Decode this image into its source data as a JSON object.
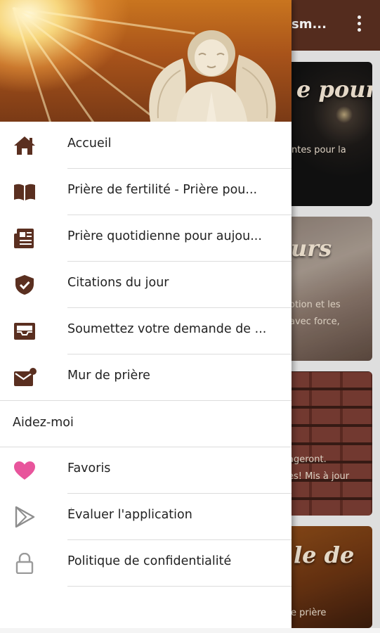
{
  "app_bar": {
    "title": "sm...",
    "color": "#5a2f20"
  },
  "background_cards": [
    {
      "title": "e pour",
      "lines": [
        "ntes pour la"
      ]
    },
    {
      "title": "urs",
      "lines": [
        "otion et les",
        "avec force,"
      ]
    },
    {
      "title": "",
      "lines": [
        "ageront.",
        "es! Mis à jour"
      ]
    },
    {
      "title": "le de",
      "lines": [
        "e prière"
      ]
    }
  ],
  "drawer": {
    "header_image": "praying-angel-statue-sunlight",
    "icon_color": "#5a2f20",
    "items": [
      {
        "label": "Accueil",
        "icon": "home-icon"
      },
      {
        "label": "Prière de fertilité - Prière pou...",
        "icon": "book-icon"
      },
      {
        "label": "Prière quotidienne pour aujou...",
        "icon": "newspaper-icon"
      },
      {
        "label": "Citations du jour",
        "icon": "shield-check-icon"
      },
      {
        "label": "Soumettez votre demande de ...",
        "icon": "inbox-icon"
      },
      {
        "label": "Mur de prière",
        "icon": "mail-notification-icon"
      }
    ],
    "section_header": "Aidez-moi",
    "help_items": [
      {
        "label": "Favoris",
        "icon": "heart-icon",
        "color": "#e8559c"
      },
      {
        "label": "Évaluer l'application",
        "icon": "play-store-icon",
        "color": "#8e8e8e"
      },
      {
        "label": "Politique de confidentialité",
        "icon": "lock-icon",
        "color": "#9a9a9a"
      }
    ]
  }
}
